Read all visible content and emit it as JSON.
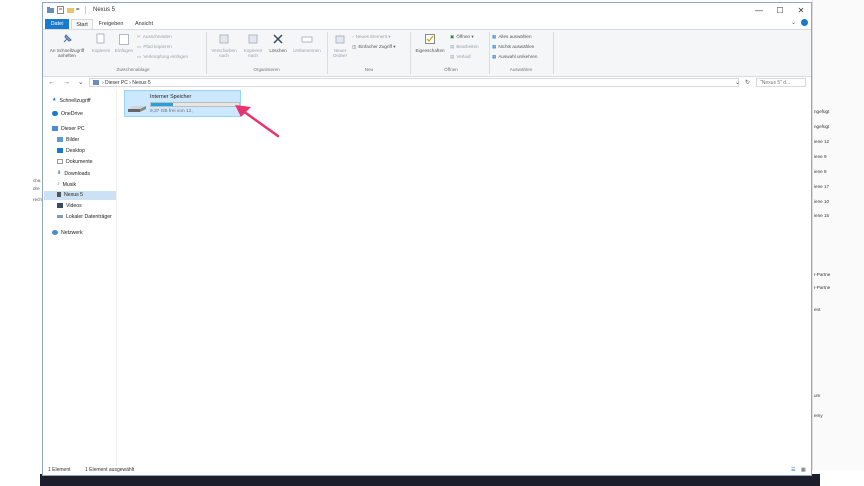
{
  "window": {
    "title": "Nexus 5",
    "controls": {
      "minimize": "—",
      "maximize": "☐",
      "close": "✕"
    }
  },
  "ribbon_tabs": [
    "Datei",
    "Start",
    "Freigeben",
    "Ansicht"
  ],
  "ribbon": {
    "clipboard": {
      "pin": "An Schnellzugriff anheften",
      "copy": "Kopieren",
      "paste": "Einfügen",
      "cut": "Ausschneiden",
      "copy_path": "Pfad kopieren",
      "paste_shortcut": "Verknüpfung einfügen",
      "label": "Zwischenablage"
    },
    "organize": {
      "move": "Verschieben nach",
      "copy_to": "Kopieren nach",
      "delete": "Löschen",
      "rename": "Umbenennen",
      "label": "Organisieren"
    },
    "new": {
      "new_folder": "Neuer Ordner",
      "new_item": "Neues Element",
      "easy_access": "Einfacher Zugriff",
      "label": "Neu"
    },
    "open": {
      "properties": "Eigenschaften",
      "open": "Öffnen",
      "edit": "Bearbeiten",
      "history": "Verlauf",
      "label": "Öffnen"
    },
    "select": {
      "select_all": "Alles auswählen",
      "select_none": "Nichts auswählen",
      "invert": "Auswahl umkehren",
      "label": "Auswählen"
    }
  },
  "address": {
    "nav_arrows": "← → ⌄ ↑",
    "path": "› Dieser PC › Nexus 5",
    "search_placeholder": "\"Nexus 5\" d..."
  },
  "nav": {
    "quick_access": "Schnellzugriff",
    "onedrive": "OneDrive",
    "this_pc": "Dieser PC",
    "pictures": "Bilder",
    "desktop": "Desktop",
    "documents": "Dokumente",
    "downloads": "Downloads",
    "music": "Musik",
    "nexus": "Nexus 5",
    "videos": "Videos",
    "local_disk": "Lokaler Datenträger",
    "network": "Netzwerk"
  },
  "drive": {
    "name": "Interner Speicher",
    "free_text": "9,37 GB frei von 12,",
    "used_fraction": 0.25
  },
  "status": {
    "count": "1 Element",
    "selected": "1 Element ausgewählt"
  },
  "background_right": [
    "ngefügt",
    "ngefügt",
    "iene 12",
    "iene 9",
    "iene 8",
    "iene 17",
    "iene 10",
    "iene 15",
    "I-Partne",
    "I-Partne",
    "ent",
    "um",
    "emy"
  ],
  "background_left": [
    "cha",
    "dre",
    "rech"
  ],
  "colors": {
    "accent": "#1979ca",
    "selection": "#cce8ff",
    "bar": "#26a0da",
    "arrow": "#e8336b"
  }
}
